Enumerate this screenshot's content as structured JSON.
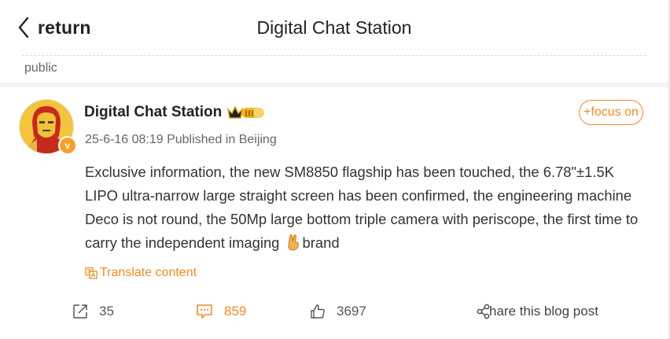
{
  "header": {
    "back_label": "return",
    "title": "Digital Chat Station"
  },
  "section": {
    "label": "public"
  },
  "post": {
    "author": "Digital Chat Station",
    "badge_level": "III",
    "verified_mark": "v",
    "meta": "25-6-16 08:19 Published in Beijing",
    "follow_label": "+focus on",
    "content_before_emoji": "Exclusive information, the new SM8850 flagship has been touched, the 6.78\"±1.5K LIPO ultra-narrow large straight screen has been confirmed, the engineering machine Deco is not round, the 50Mp large bottom triple camera with periscope, the first time to carry the independent imaging ",
    "emoji": "victory-hand-emoji",
    "content_after_emoji": "brand",
    "translate_label": "Translate content"
  },
  "actions": {
    "repost_count": "35",
    "comment_count": "859",
    "like_count": "3697",
    "share_label": "hare this blog post"
  },
  "colors": {
    "accent": "#f08a24",
    "text": "#333333",
    "muted": "#666666",
    "background": "#f2f2f2"
  },
  "icons": [
    "chevron-left-icon",
    "crown-badge-icon",
    "verified-icon",
    "translate-icon",
    "repost-icon",
    "comment-icon",
    "like-icon",
    "share-icon"
  ]
}
